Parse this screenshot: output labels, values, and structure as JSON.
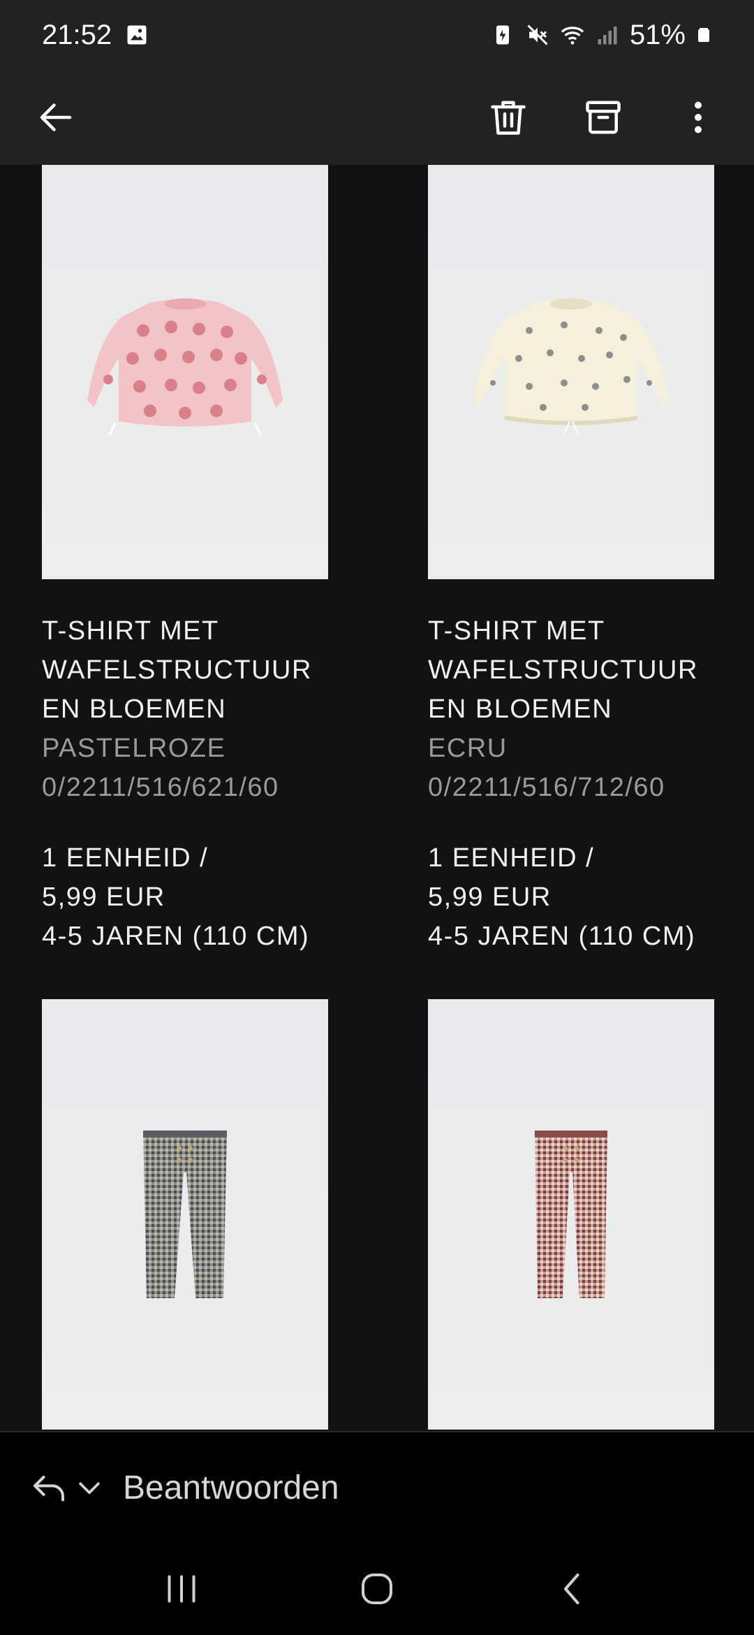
{
  "status": {
    "time": "21:52",
    "battery": "51%"
  },
  "app_bar": {
    "back_icon": "arrow-left-icon",
    "delete_icon": "trash-icon",
    "archive_icon": "archive-icon",
    "more_icon": "more-vertical-icon"
  },
  "products": [
    {
      "title_line1": "T-SHIRT MET",
      "title_line2": "WAFELSTRUCTUUR",
      "title_line3": "EN BLOEMEN",
      "color": "PASTELROZE",
      "ref": "0/2211/516/621/60",
      "qty_line1": "1 EENHEID /",
      "qty_line2": "5,99 EUR",
      "qty_line3": "4-5 JAREN (110 CM)",
      "image": "pink floral sweatshirt"
    },
    {
      "title_line1": "T-SHIRT MET",
      "title_line2": "WAFELSTRUCTUUR",
      "title_line3": "EN BLOEMEN",
      "color": "ECRU",
      "ref": "0/2211/516/712/60",
      "qty_line1": "1 EENHEID /",
      "qty_line2": "5,99 EUR",
      "qty_line3": "4-5 JAREN (110 CM)",
      "image": "ecru floral sweatshirt"
    },
    {
      "image": "grey check leggings"
    },
    {
      "image": "pink check leggings"
    }
  ],
  "reply": {
    "label": "Beantwoorden"
  },
  "colors": {
    "background": "#121212",
    "bar": "#222222",
    "secondary_text": "#9a9a9a"
  }
}
